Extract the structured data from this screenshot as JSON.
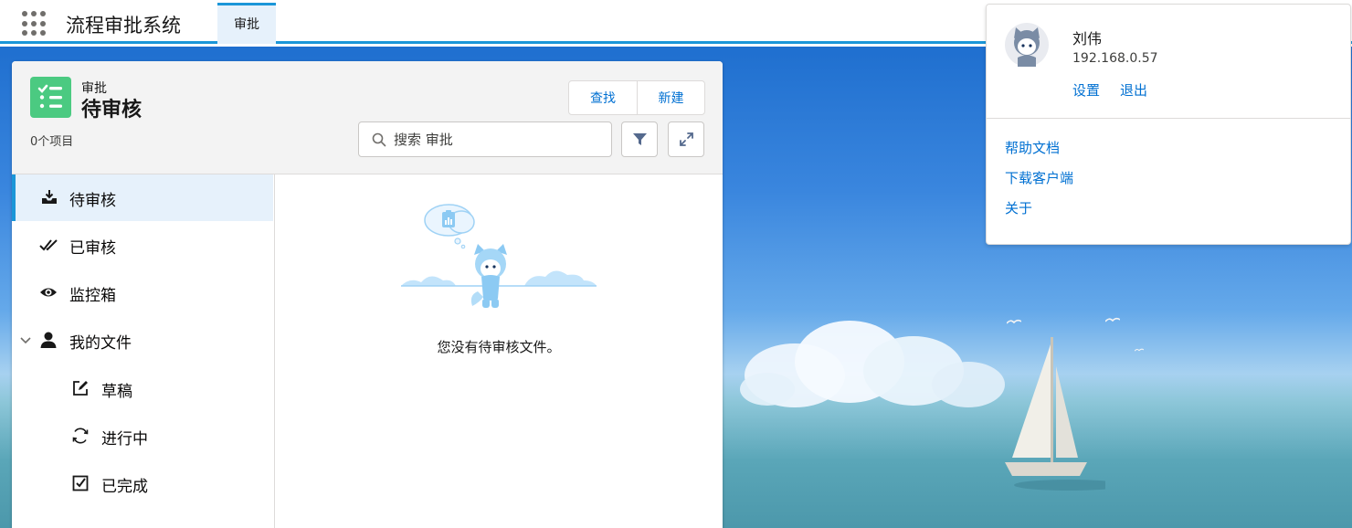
{
  "header": {
    "app_title": "流程审批系统",
    "tabs": [
      {
        "label": "审批",
        "active": true
      }
    ]
  },
  "card": {
    "object_subtitle": "审批",
    "title": "待审核",
    "item_count": "0个项目",
    "buttons": {
      "find": "查找",
      "new": "新建"
    },
    "search": {
      "placeholder": "搜索 审批",
      "value": ""
    }
  },
  "sidebar": {
    "items": [
      {
        "label": "待审核",
        "icon": "inbox-download-icon",
        "active": true
      },
      {
        "label": "已审核",
        "icon": "double-check-icon"
      },
      {
        "label": "监控箱",
        "icon": "eye-icon"
      },
      {
        "label": "我的文件",
        "icon": "user-icon",
        "expanded": true
      },
      {
        "label": "草稿",
        "icon": "edit-icon"
      },
      {
        "label": "进行中",
        "icon": "refresh-icon"
      },
      {
        "label": "已完成",
        "icon": "checkbox-icon"
      }
    ]
  },
  "empty_state": {
    "message": "您没有待审核文件。"
  },
  "user_menu": {
    "name": "刘伟",
    "ip": "192.168.0.57",
    "settings": "设置",
    "logout": "退出",
    "links": [
      "帮助文档",
      "下载客户端",
      "关于"
    ]
  },
  "colors": {
    "accent": "#1b96d8",
    "link": "#0070d2",
    "object_icon": "#4bca81",
    "active_nav_bg": "#e6f1fb"
  }
}
